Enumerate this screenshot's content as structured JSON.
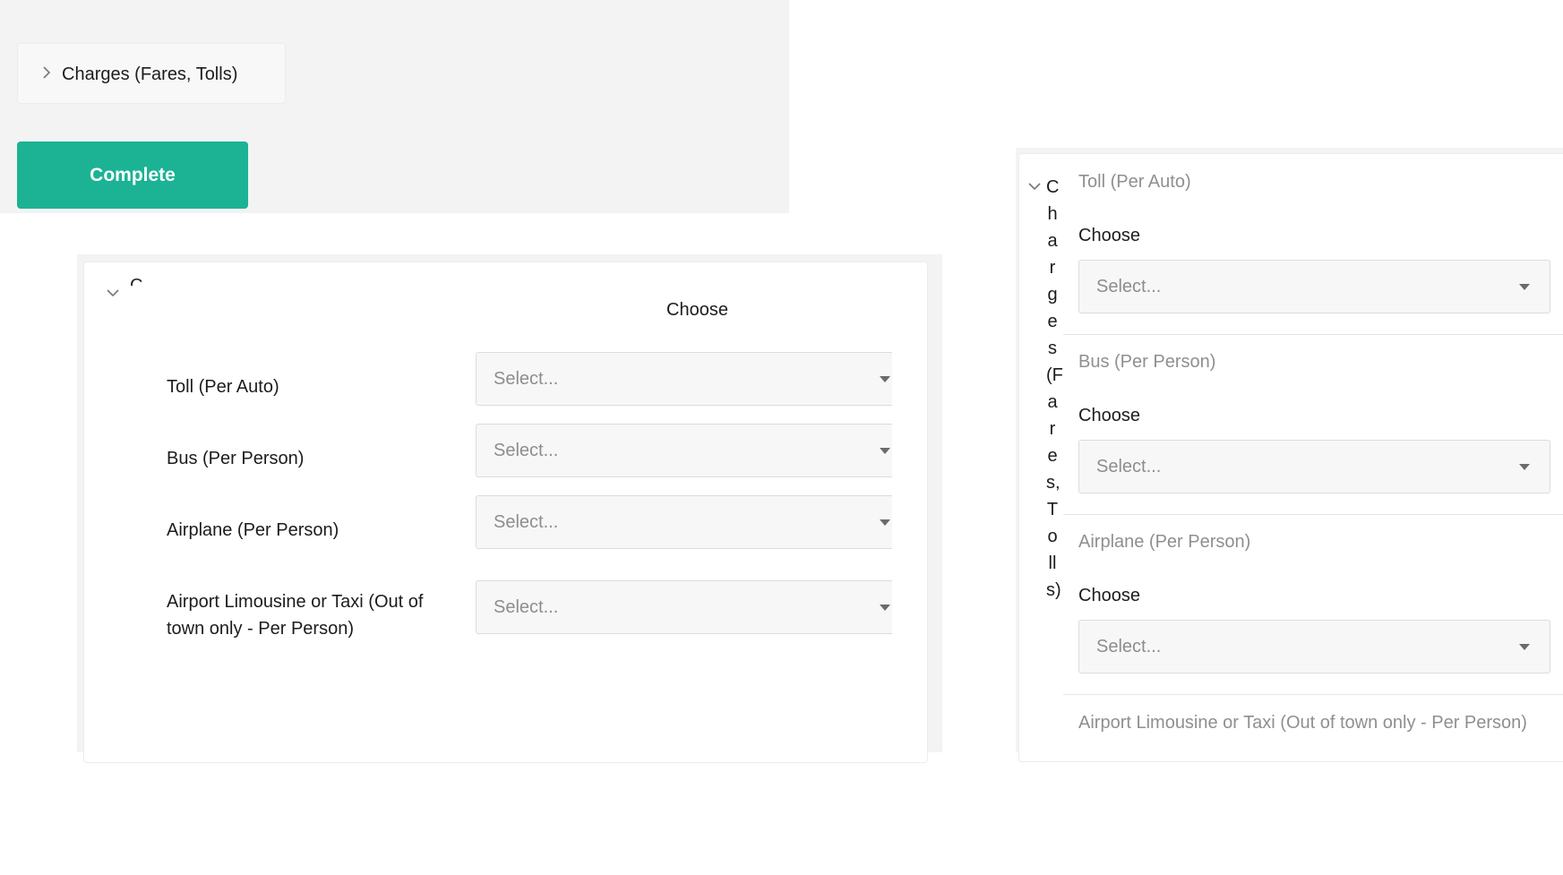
{
  "panel_collapsed": {
    "accordion_title": "Charges (Fares, Tolls)",
    "complete_label": "Complete"
  },
  "panel_desktop": {
    "accordion_title_fragment": "C",
    "column_header": "Choose",
    "rows": [
      {
        "label": "Toll (Per Auto)",
        "placeholder": "Select..."
      },
      {
        "label": "Bus (Per Person)",
        "placeholder": "Select..."
      },
      {
        "label": "Airplane (Per Person)",
        "placeholder": "Select..."
      },
      {
        "label": "Airport Limousine or Taxi (Out of town only - Per Person)",
        "placeholder": "Select..."
      }
    ]
  },
  "panel_mobile": {
    "accordion_title": "Charges(Fares,Tolls)",
    "choose_label": "Choose",
    "sections": [
      {
        "title": "Toll (Per Auto)",
        "placeholder": "Select..."
      },
      {
        "title": "Bus (Per Person)",
        "placeholder": "Select..."
      },
      {
        "title": "Airplane (Per Person)",
        "placeholder": "Select..."
      },
      {
        "title": "Airport Limousine or Taxi (Out of town only - Per Person)"
      }
    ]
  },
  "colors": {
    "accent": "#1bb394",
    "page_background": "#f3f3f3",
    "placeholder_text": "#8d8d8d",
    "section_title_text": "#8f8f8f"
  },
  "icons": {
    "collapsed_chevron": "chevron-right-icon",
    "expanded_chevron": "chevron-down-icon",
    "select_caret": "caret-down-icon"
  }
}
